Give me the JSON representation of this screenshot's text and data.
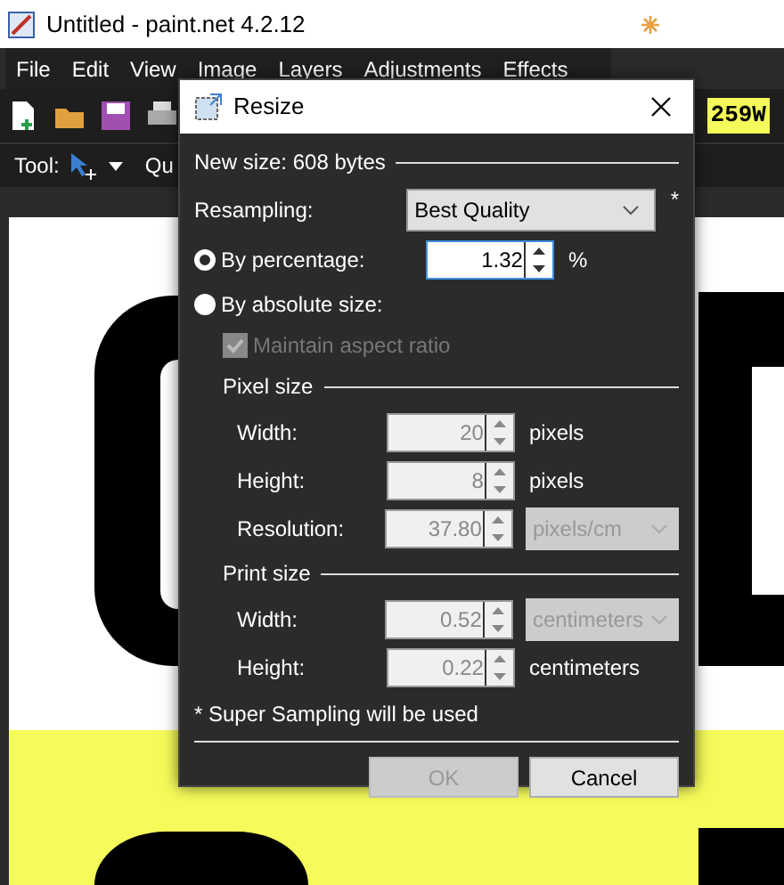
{
  "window": {
    "title": "Untitled - paint.net 4.2.12"
  },
  "menu": [
    "File",
    "Edit",
    "View",
    "Image",
    "Layers",
    "Adjustments",
    "Effects"
  ],
  "toolbar": {
    "image_tab_text": "259W",
    "tool_label": "Tool:",
    "cut_label": "Qu"
  },
  "dialog": {
    "title": "Resize",
    "new_size": "New size: 608 bytes",
    "resampling_label": "Resampling:",
    "resampling_value": "Best Quality",
    "resampling_note": "*",
    "modes": [
      {
        "label": "By percentage:",
        "selected": true
      },
      {
        "label": "By absolute size:",
        "selected": false
      }
    ],
    "percentage": {
      "value": "1.32",
      "unit": "%",
      "disabled": false
    },
    "maintain_aspect": {
      "label": "Maintain aspect ratio",
      "checked": true,
      "disabled": true
    },
    "sections": [
      {
        "heading": "Pixel size",
        "rows": [
          {
            "label": "Width:",
            "value": "20",
            "unit": "pixels",
            "kind": "text",
            "disabled": true
          },
          {
            "label": "Height:",
            "value": "8",
            "unit": "pixels",
            "kind": "text",
            "disabled": true
          },
          {
            "label": "Resolution:",
            "value": "37.80",
            "unit": "pixels/cm",
            "kind": "select",
            "disabled": true
          }
        ]
      },
      {
        "heading": "Print size",
        "rows": [
          {
            "label": "Width:",
            "value": "0.52",
            "unit": "centimeters",
            "kind": "select",
            "disabled": true
          },
          {
            "label": "Height:",
            "value": "0.22",
            "unit": "centimeters",
            "kind": "text",
            "disabled": true
          }
        ]
      }
    ],
    "footnote": "* Super Sampling will be used",
    "buttons": [
      {
        "label": "OK",
        "disabled": true
      },
      {
        "label": "Cancel",
        "disabled": false
      }
    ]
  }
}
